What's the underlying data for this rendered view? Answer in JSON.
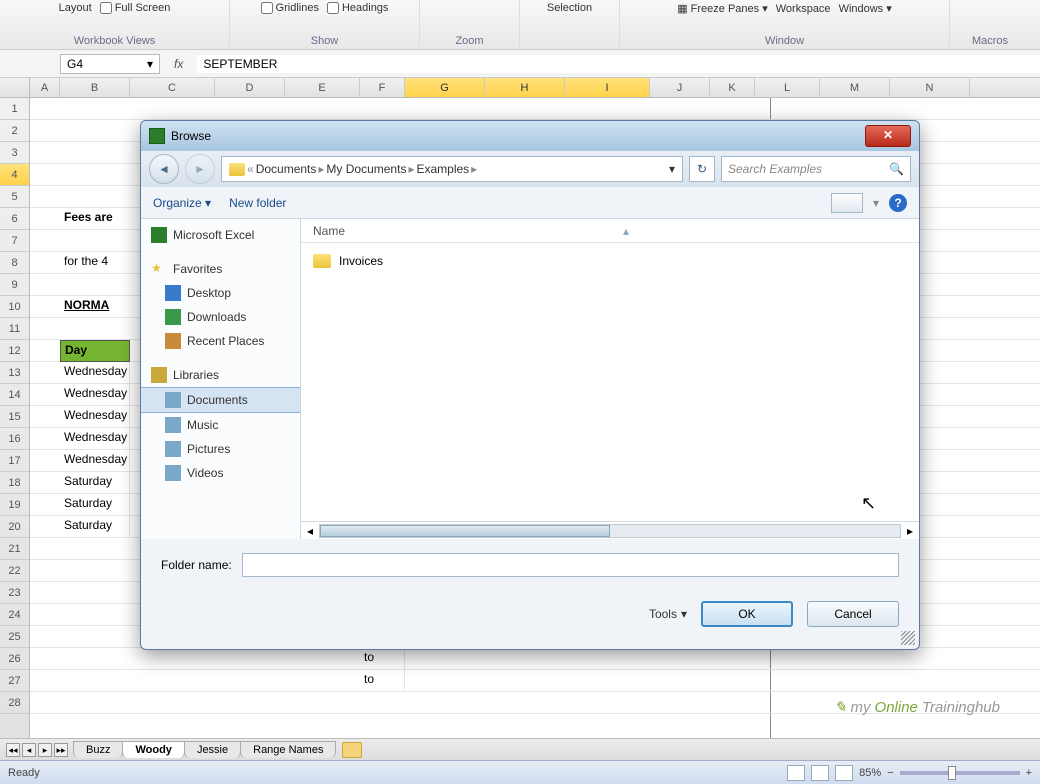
{
  "ribbon": {
    "layout": "Layout",
    "full_screen": "Full Screen",
    "gridlines": "Gridlines",
    "headings": "Headings",
    "freeze_panes": "Freeze Panes",
    "workspace": "Workspace",
    "windows": "Windows",
    "groups": {
      "views": "Workbook Views",
      "show": "Show",
      "zoom": "Zoom",
      "selection": "Selection",
      "window": "Window",
      "macros": "Macros"
    }
  },
  "formula_bar": {
    "cell_ref": "G4",
    "fx": "fx",
    "formula": "SEPTEMBER"
  },
  "columns": [
    "A",
    "B",
    "C",
    "D",
    "E",
    "F",
    "G",
    "H",
    "I",
    "J",
    "K",
    "L",
    "M",
    "N"
  ],
  "selected_cols": [
    "G",
    "H",
    "I"
  ],
  "rows": [
    1,
    2,
    3,
    4,
    5,
    6,
    7,
    8,
    9,
    10,
    11,
    12,
    13,
    14,
    15,
    16,
    17,
    18,
    19,
    20,
    21,
    22,
    23,
    24,
    25,
    26,
    27,
    28
  ],
  "selected_row": 4,
  "sheet_content": {
    "r6": "Fees are",
    "r8": "for the 4",
    "r10": "NORMA",
    "r12_header": "Day",
    "days": [
      "Wednesday",
      "Wednesday",
      "Wednesday",
      "Wednesday",
      "Wednesday",
      "Saturday",
      "Saturday",
      "Saturday"
    ],
    "to": "to"
  },
  "sheet_tabs": {
    "nav": [
      "◂◂",
      "◂",
      "▸",
      "▸▸"
    ],
    "tabs": [
      "Buzz",
      "Woody",
      "Jessie",
      "Range Names"
    ],
    "active": "Woody"
  },
  "status_bar": {
    "ready": "Ready",
    "zoom": "85%"
  },
  "dialog": {
    "title": "Browse",
    "breadcrumb": [
      "Documents",
      "My Documents",
      "Examples"
    ],
    "search_placeholder": "Search Examples",
    "organize": "Organize",
    "new_folder": "New folder",
    "column_name": "Name",
    "sidebar": {
      "excel": "Microsoft Excel",
      "favorites": "Favorites",
      "desktop": "Desktop",
      "downloads": "Downloads",
      "recent": "Recent Places",
      "libraries": "Libraries",
      "documents": "Documents",
      "music": "Music",
      "pictures": "Pictures",
      "videos": "Videos"
    },
    "files": [
      "Invoices"
    ],
    "folder_name_label": "Folder name:",
    "folder_name_value": "",
    "tools": "Tools",
    "ok": "OK",
    "cancel": "Cancel"
  },
  "watermark": {
    "pre": "my",
    "mid": "Online",
    "post": "Traininghub"
  },
  "col_widths": {
    "A": 30,
    "B": 70,
    "C": 85,
    "D": 70,
    "E": 75,
    "F": 45,
    "G": 80,
    "H": 80,
    "I": 85,
    "J": 60,
    "K": 45,
    "L": 65,
    "M": 70,
    "N": 80
  }
}
